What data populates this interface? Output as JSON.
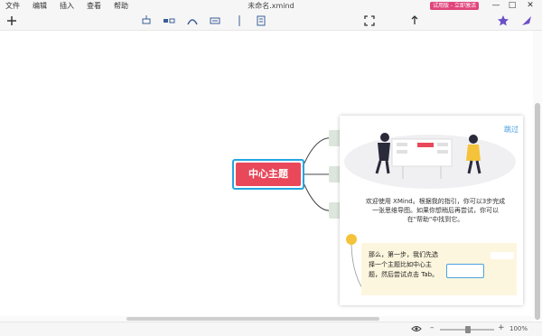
{
  "menu": [
    "文件",
    "编辑",
    "插入",
    "查看",
    "帮助"
  ],
  "window": {
    "title": "未命名.xmind",
    "trial_badge": "试用版 - 立即激活"
  },
  "window_buttons": {
    "minimize": "—",
    "maximize": "□",
    "close": "✕"
  },
  "toolbar_icons": [
    "add-icon",
    "topic-icon",
    "subtopic-icon",
    "relationship-icon",
    "summary-icon",
    "boundary-icon",
    "notes-icon",
    "zen-mode-icon",
    "share-icon",
    "theme-icon",
    "style-icon"
  ],
  "mindmap": {
    "central_topic": "中心主题"
  },
  "guide": {
    "skip": "跳过",
    "welcome_line1": "欢迎使用 XMind。根据我的指引，你可以3步完成",
    "welcome_line2": "一张思维导图。如果你想稍后再尝试，你可以",
    "welcome_line3": "在\"帮助\"中找到它。",
    "step_line1": "那么，第一步，我们先选",
    "step_line2": "择一个主题比如中心主",
    "step_line3": "题，然后尝试点击 Tab。"
  },
  "status": {
    "zoom": "100%"
  },
  "colors": {
    "central_topic_fill": "#e8485a",
    "selection_border": "#25a6e0",
    "trial_badge": "#e0457b",
    "accent": "#3a5d9a",
    "step_bg": "#fdf6de"
  }
}
